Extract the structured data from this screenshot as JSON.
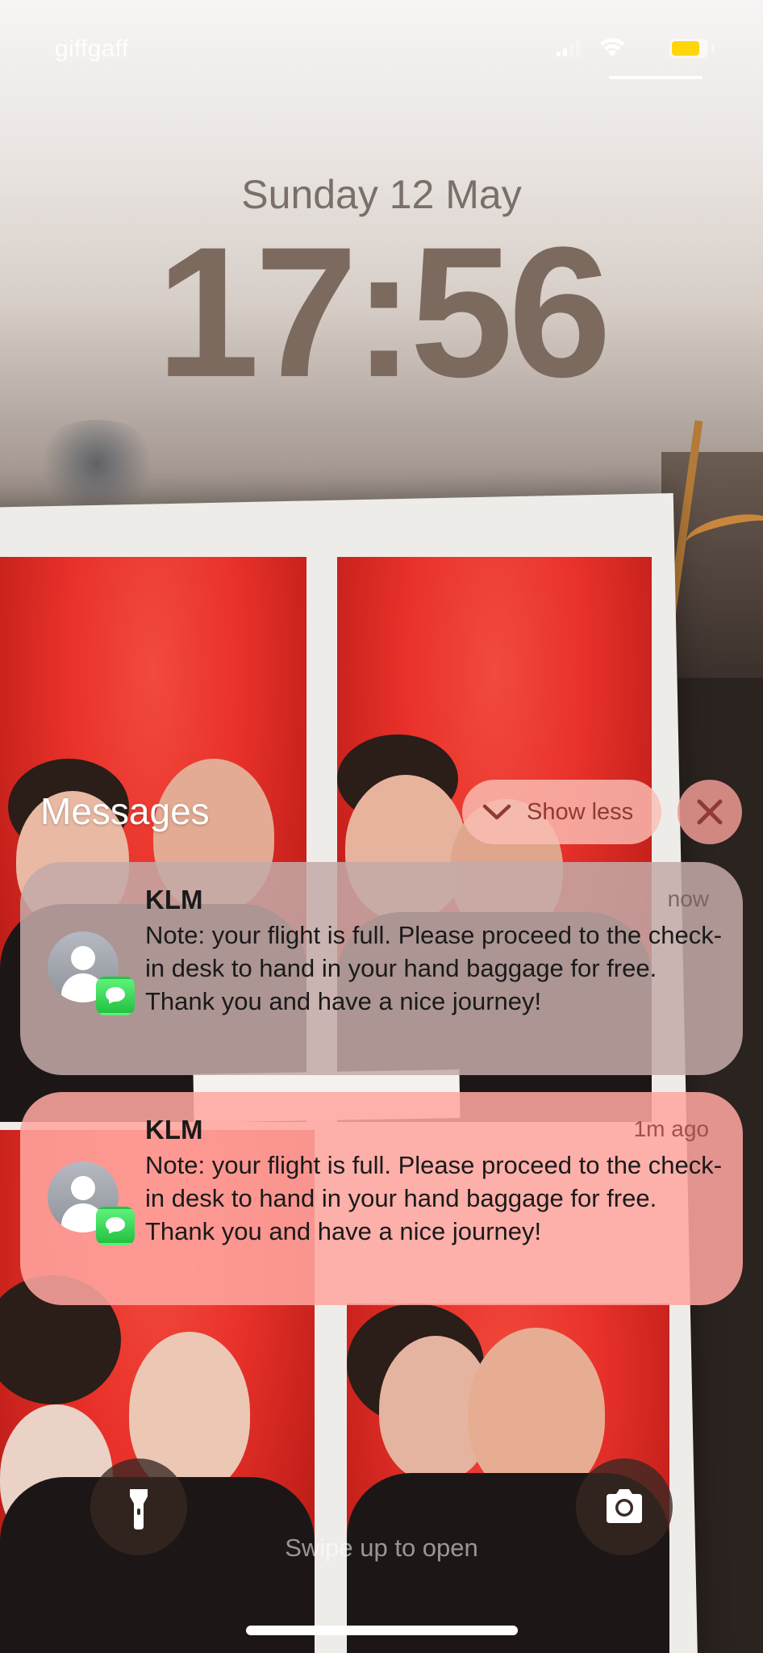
{
  "status_bar": {
    "carrier": "giffgaff",
    "battery_color": "#ffd60a"
  },
  "lock_screen": {
    "date": "Sunday 12 May",
    "time": "17:56",
    "time_color": "#7d6a5f"
  },
  "notification_group": {
    "title": "Messages",
    "show_less_label": "Show less",
    "show_less_icon": "chevron-down-icon",
    "close_icon": "close-icon",
    "items": [
      {
        "sender": "KLM",
        "time": "now",
        "body": "Note: your flight is full. Please proceed to the check-in desk to hand in your hand baggage for free. Thank you and have a nice journey!",
        "avatar_icon": "contact-avatar-icon",
        "app_icon": "messages-app-icon"
      },
      {
        "sender": "KLM",
        "time": "1m ago",
        "body": "Note: your flight is full. Please proceed to the check-in desk to hand in your hand baggage for free. Thank you and have a nice journey!",
        "avatar_icon": "contact-avatar-icon",
        "app_icon": "messages-app-icon"
      }
    ]
  },
  "bottom": {
    "flashlight_icon": "flashlight-icon",
    "camera_icon": "camera-icon",
    "swipe_hint": "Swipe up to open"
  }
}
